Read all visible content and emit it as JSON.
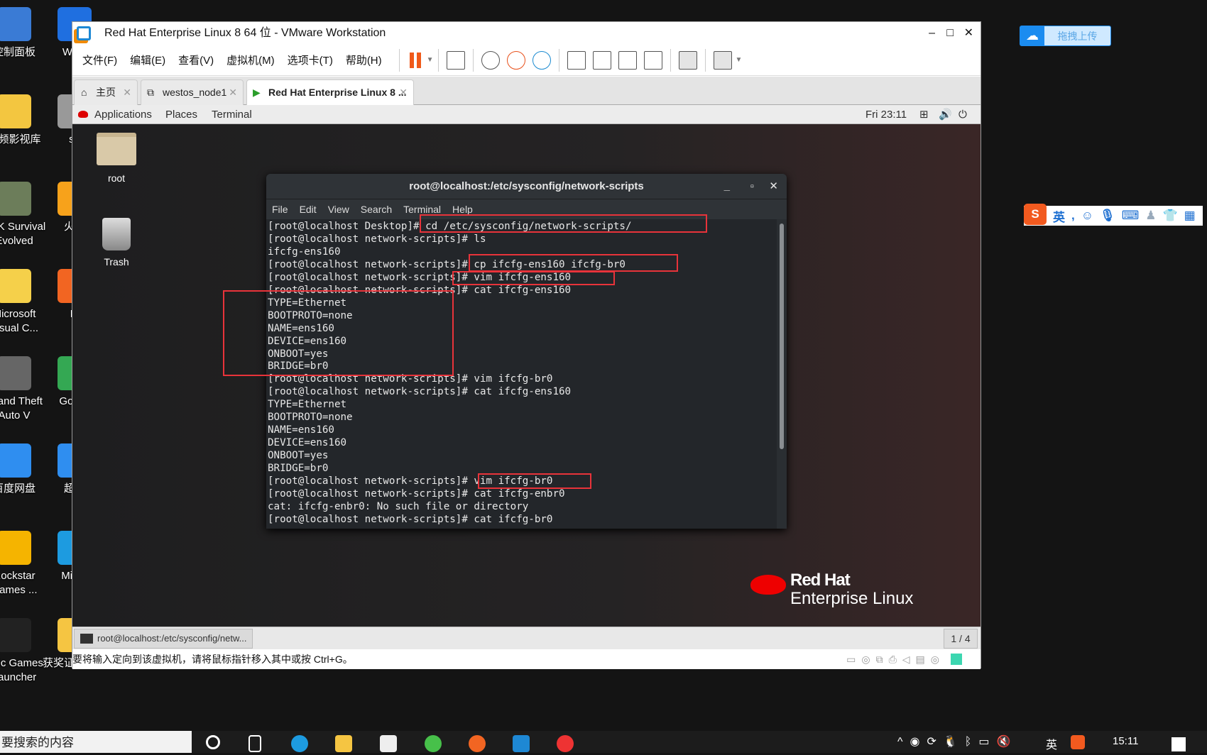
{
  "windows_desktop": {
    "icons": [
      {
        "label": "控制面板",
        "col": 0
      },
      {
        "label": "WPS",
        "col": 1
      },
      {
        "label": "视频影视库",
        "col": 0
      },
      {
        "label": "so",
        "col": 1
      },
      {
        "label": "ARK Survival Evolved",
        "col": 0
      },
      {
        "label": "火绒",
        "col": 1
      },
      {
        "label": "Microsoft Visual C...",
        "col": 0
      },
      {
        "label": "Fi",
        "col": 1
      },
      {
        "label": "Grand Theft Auto V",
        "col": 0
      },
      {
        "label": "Go Ch",
        "col": 1
      },
      {
        "label": "百度网盘",
        "col": 0
      },
      {
        "label": "超星",
        "col": 1
      },
      {
        "label": "Rockstar Games ...",
        "col": 0
      },
      {
        "label": "Mic E",
        "col": 1
      },
      {
        "label": "Epic Games Launcher",
        "col": 0
      },
      {
        "label": "获奖证书合集",
        "col": 1
      }
    ],
    "upload_button": "拖拽上传",
    "ime_toolbar": {
      "mode": "英"
    }
  },
  "vmware": {
    "title": "Red Hat Enterprise Linux 8 64 位 - VMware Workstation",
    "menu": [
      "文件(F)",
      "编辑(E)",
      "查看(V)",
      "虚拟机(M)",
      "选项卡(T)",
      "帮助(H)"
    ],
    "tabs": [
      {
        "label": "主页",
        "icon": "home-icon"
      },
      {
        "label": "westos_node1",
        "icon": "vm-icon"
      },
      {
        "label": "Red Hat Enterprise Linux 8 ...",
        "icon": "vm-running-icon",
        "active": true
      }
    ],
    "status_text": "要将输入定向到该虚拟机，请将鼠标指针移入其中或按 Ctrl+G。"
  },
  "guest": {
    "topbar": {
      "applications": "Applications",
      "places": "Places",
      "terminal": "Terminal",
      "clock": "Fri 23:11"
    },
    "desktop_icons": [
      {
        "label": "root"
      },
      {
        "label": "Trash"
      }
    ],
    "logo": {
      "line1": "Red Hat",
      "line2": "Enterprise Linux"
    },
    "bottom_panel": {
      "task": "root@localhost:/etc/sysconfig/netw...",
      "workspace": "1 / 4"
    },
    "terminal": {
      "title": "root@localhost:/etc/sysconfig/network-scripts",
      "menu": [
        "File",
        "Edit",
        "View",
        "Search",
        "Terminal",
        "Help"
      ],
      "lines": [
        "[root@localhost Desktop]# cd /etc/sysconfig/network-scripts/",
        "[root@localhost network-scripts]# ls",
        "ifcfg-ens160",
        "[root@localhost network-scripts]# cp ifcfg-ens160 ifcfg-br0",
        "[root@localhost network-scripts]# vim ifcfg-ens160",
        "[root@localhost network-scripts]# cat ifcfg-ens160",
        "TYPE=Ethernet",
        "BOOTPROTO=none",
        "NAME=ens160",
        "DEVICE=ens160",
        "ONBOOT=yes",
        "BRIDGE=br0",
        "[root@localhost network-scripts]# vim ifcfg-br0",
        "[root@localhost network-scripts]# cat ifcfg-ens160",
        "TYPE=Ethernet",
        "BOOTPROTO=none",
        "NAME=ens160",
        "DEVICE=ens160",
        "ONBOOT=yes",
        "BRIDGE=br0",
        "[root@localhost network-scripts]# vim ifcfg-br0",
        "[root@localhost network-scripts]# cat ifcfg-enbr0",
        "cat: ifcfg-enbr0: No such file or directory",
        "[root@localhost network-scripts]# cat ifcfg-br0"
      ]
    },
    "annotation_color": "#e8333a"
  },
  "taskbar": {
    "search_text": "要搜索的内容",
    "clock": "15:11",
    "ime": "英"
  }
}
